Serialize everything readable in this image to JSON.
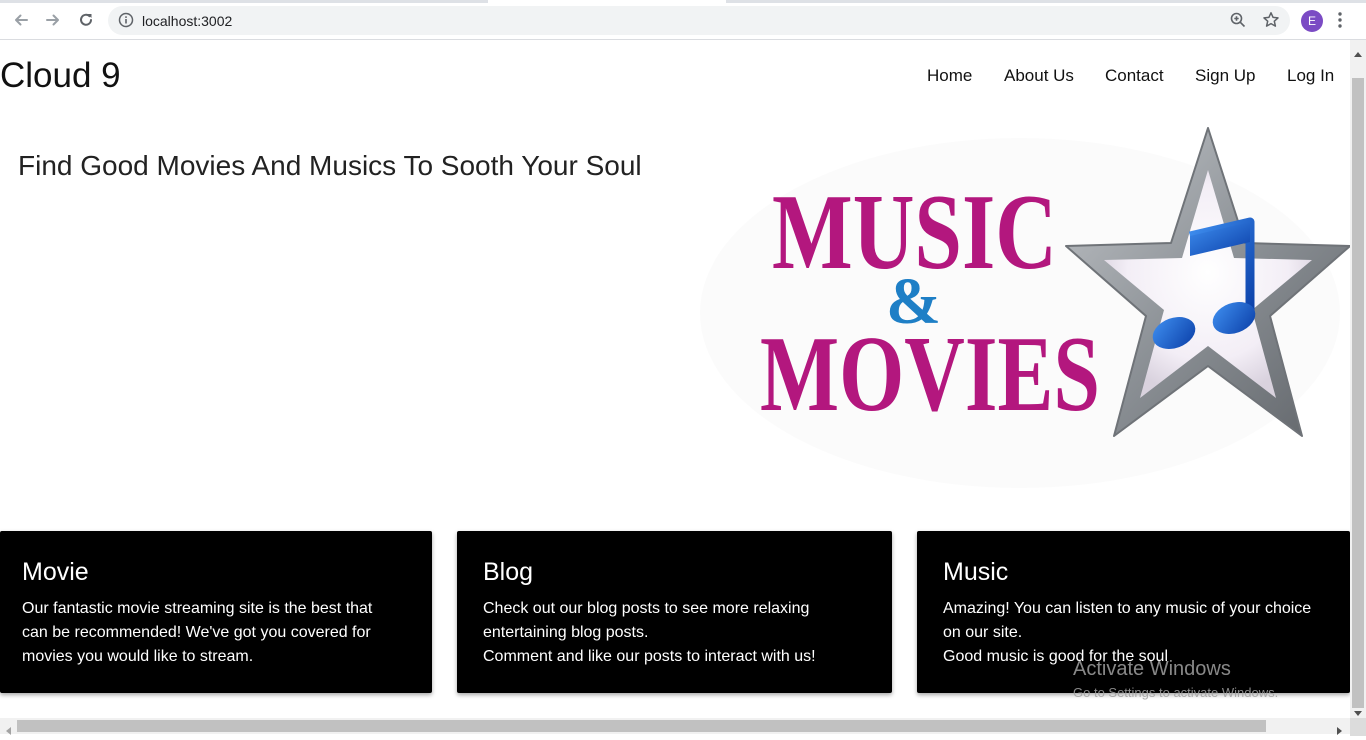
{
  "browser": {
    "url": "localhost:3002",
    "profile_initial": "E",
    "colors": {
      "profile_avatar": "#7b4bc4",
      "omnibox_bg": "#f1f3f4"
    },
    "icons": [
      "back-arrow-icon",
      "forward-arrow-icon",
      "reload-icon",
      "info-icon",
      "zoom-icon",
      "star-icon",
      "kebab-menu-icon"
    ]
  },
  "site": {
    "logo": "Cloud 9",
    "nav": [
      "Home",
      "About Us",
      "Contact",
      "Sign Up",
      "Log In"
    ],
    "hero": {
      "title": "Find Good Movies And Musics To Sooth Your Soul",
      "image": {
        "word_top": "MUSIC",
        "ampersand": "&",
        "word_bottom": "MOVIES",
        "colors": {
          "text": "#b3177e",
          "ampersand": "#1e7fc6",
          "note": "#1560c9",
          "star": "#9ea3a8"
        }
      }
    },
    "cards": [
      {
        "title": "Movie",
        "lines": [
          "Our fantastic movie streaming site is the best that",
          "can be recommended! We've got you covered for",
          "movies you would like to stream."
        ]
      },
      {
        "title": "Blog",
        "lines": [
          "Check out our blog posts to see more relaxing",
          "entertaining blog posts.",
          "Comment and like our posts to interact with us!"
        ]
      },
      {
        "title": "Music",
        "lines": [
          "Amazing! You can listen to any music of your choice",
          "on our site.",
          "Good music is good for the soul"
        ]
      }
    ]
  },
  "os_watermark": {
    "line1": "Activate Windows",
    "line2": "Go to Settings to activate Windows."
  }
}
